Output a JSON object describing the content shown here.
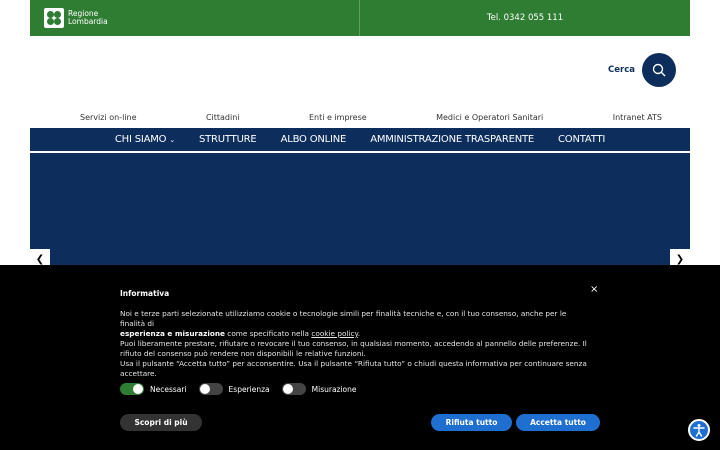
{
  "header": {
    "logo_line1": "Regione",
    "logo_line2": "Lombardia",
    "phone": "Tel. 0342 055 111"
  },
  "search": {
    "label": "Cerca",
    "icon": "search-icon"
  },
  "subnav": {
    "items": [
      "Servizi on-line",
      "Cittadini",
      "Enti e imprese",
      "Medici e Operatori Sanitari",
      "Intranet ATS"
    ]
  },
  "mainnav": {
    "items": [
      "CHI SIAMO",
      "STRUTTURE",
      "ALBO ONLINE",
      "AMMINISTRAZIONE TRASPARENTE",
      "CONTATTI"
    ]
  },
  "cookie": {
    "title": "Informativa",
    "close": "×",
    "body_p1": "Noi e terze parti selezionate utilizziamo cookie o tecnologie simili per finalità tecniche e, con il tuo consenso, anche per le finalità di",
    "body_bold": "esperienza e misurazione",
    "body_p2": " come specificato nella ",
    "body_link": "cookie policy",
    "body_p3": "Puoi liberamente prestare, rifiutare o revocare il tuo consenso, in qualsiasi momento, accedendo al pannello delle preferenze. Il rifiuto del consenso può rendere non disponibili le relative funzioni.",
    "body_p4": "Usa il pulsante “Accetta tutto” per acconsentire. Usa il pulsante “Rifiuta tutto” o chiudi questa informativa per continuare senza accettare.",
    "toggles": [
      {
        "label": "Necessari",
        "on": true
      },
      {
        "label": "Esperienza",
        "on": false
      },
      {
        "label": "Misurazione",
        "on": false
      }
    ],
    "btn_more": "Scopri di più",
    "btn_reject": "Rifiuta tutto",
    "btn_accept": "Accetta tutto"
  },
  "colors": {
    "green": "#2e7d32",
    "navy": "#0d2e5c",
    "blue": "#1f6fd1"
  }
}
